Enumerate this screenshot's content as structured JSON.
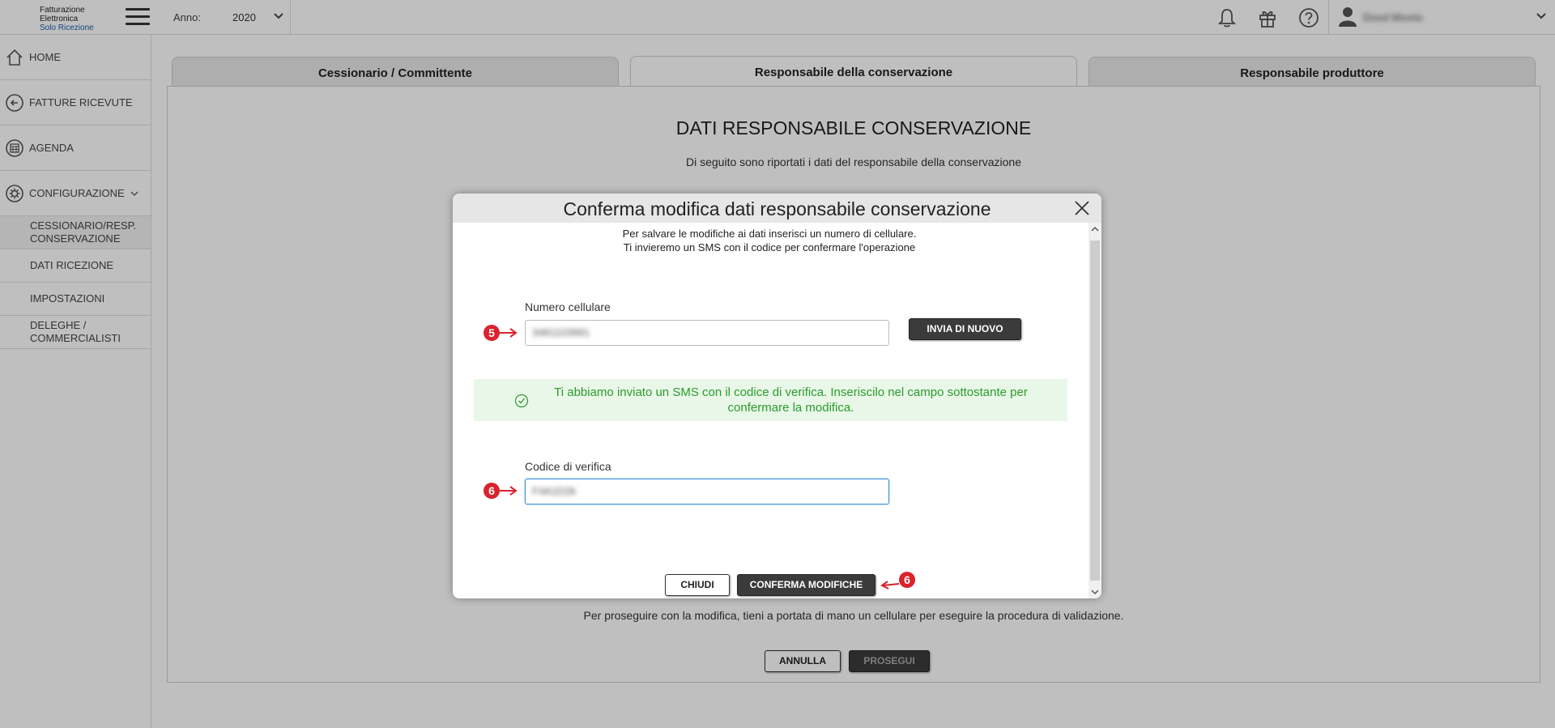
{
  "app": {
    "logo_line1": "Fatturazione",
    "logo_line2": "Elettronica",
    "logo_line3": "Solo Ricezione",
    "year_label": "Anno:",
    "year_value": "2020",
    "user_name": "Dxxxl Mxxrio"
  },
  "sidebar": {
    "items": [
      {
        "label": "HOME",
        "icon": "home-icon"
      },
      {
        "label": "FATTURE RICEVUTE",
        "icon": "arrow-left-circle-icon"
      },
      {
        "label": "AGENDA",
        "icon": "calendar-icon"
      },
      {
        "label": "CONFIGURAZIONE",
        "icon": "gear-icon"
      }
    ],
    "subitems": [
      {
        "label": "CESSIONARIO/RESP. CONSERVAZIONE",
        "active": true
      },
      {
        "label": "DATI RICEZIONE"
      },
      {
        "label": "IMPOSTAZIONI"
      },
      {
        "label": "DELEGHE / COMMERCIALISTI"
      }
    ]
  },
  "tabs": [
    {
      "label": "Cessionario / Committente"
    },
    {
      "label": "Responsabile della conservazione",
      "active": true
    },
    {
      "label": "Responsabile produttore"
    }
  ],
  "page": {
    "title": "DATI RESPONSABILE CONSERVAZIONE",
    "subtitle": "Di seguito sono riportati i dati del responsabile della conservazione",
    "note": "Per proseguire con la modifica, tieni a portata di mano un cellulare per eseguire la procedura di validazione.",
    "cancel_label": "ANNULLA",
    "continue_label": "PROSEGUI"
  },
  "modal": {
    "title": "Conferma modifica dati responsabile conservazione",
    "intro_line1": "Per salvare le modifiche ai dati inserisci un numero di cellulare.",
    "intro_line2": "Ti invieremo un SMS con il codice per confermare l'operazione",
    "phone_label": "Numero cellulare",
    "phone_value": "3481103991",
    "resend_label": "INVIA DI NUOVO",
    "alert_text": "Ti abbiamo inviato un SMS con il codice di verifica. Inseriscilo nel campo sottostante per confermare la modifica.",
    "code_label": "Codice di verifica",
    "code_value": "F4A1D2k",
    "close_label": "CHIUDI",
    "confirm_label": "CONFERMA MODIFICHE"
  },
  "markers": {
    "phone": "5",
    "code": "6",
    "confirm": "6"
  },
  "colors": {
    "marker": "#d9232d",
    "alert_text": "#2b9b2b",
    "alert_bg": "#e9f7e9",
    "focus": "#3c8fdb"
  }
}
